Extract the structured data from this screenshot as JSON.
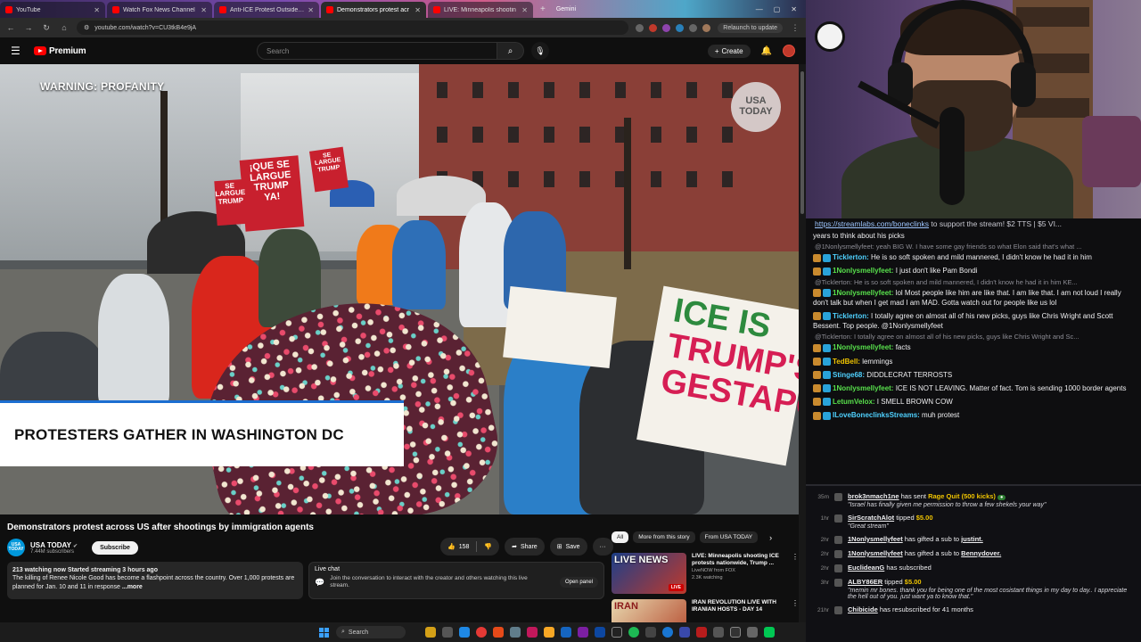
{
  "browser": {
    "tabs": [
      {
        "label": "YouTube",
        "active": false
      },
      {
        "label": "Watch Fox News Channel",
        "active": false
      },
      {
        "label": "Anti-ICE Protest Outside White",
        "active": false
      },
      {
        "label": "Demonstrators protest acr",
        "active": true
      },
      {
        "label": "LIVE: Minneapolis shootin",
        "active": false
      }
    ],
    "new_tab": "+",
    "gemini": "Gemini",
    "address": "youtube.com/watch?v=CU3tkB4e9jA",
    "relaunch": "Relaunch to update"
  },
  "yt": {
    "brand": "Premium",
    "search_placeholder": "Search",
    "create_label": "Create"
  },
  "video": {
    "warning": "WARNING: PROFANITY",
    "watermark_line1": "USA",
    "watermark_line2": "TODAY",
    "lower_third": "PROTESTERS GATHER IN WASHINGTON DC",
    "signs": {
      "que_se_1": "¡QUE SE",
      "que_se_2": "LARGUE",
      "que_se_3": "TRUMP",
      "que_se_4": "YA!",
      "se_largue_1": "SE",
      "se_largue_2": "LARGUE",
      "se_largue_3": "TRUMP",
      "ice_1": "ICE IS",
      "ice_2": "TRUMP'S",
      "ice_3": "GESTAPO"
    },
    "title": "Demonstrators protest across US after shootings by immigration agents",
    "channel": "USA TODAY",
    "channel_logo": "USA TODAY",
    "subscribers": "7.44M subscribers",
    "subscribe": "Subscribe",
    "likes": "158",
    "share": "Share",
    "save": "Save",
    "more": "···",
    "desc_meta": "213 watching now  Started streaming 3 hours ago",
    "desc_text": "The killing of Renee Nicole Good has become a flashpoint across the country. Over 1,000 protests are planned for Jan. 10 and 11 in response",
    "desc_more": "...more",
    "live_chat_title": "Live chat",
    "live_chat_text": "Join the conversation to interact with the creator and others watching this live stream.",
    "open_panel": "Open panel"
  },
  "recs": {
    "chips": [
      "All",
      "More from this story",
      "From USA TODAY"
    ],
    "items": [
      {
        "title": "LIVE: Minneapolis shooting ICE protests nationwide, Trump ...",
        "channel": "LiveNOW from FOX",
        "meta": "2.3K watching",
        "thumb_text": "LIVE NEWS",
        "badge": "LIVE"
      },
      {
        "title": "IRAN REVOLUTION LIVE WITH IRANIAN HOSTS - DAY 14",
        "channel": "",
        "meta": "",
        "thumb_text": "IRAN",
        "badge": ""
      }
    ]
  },
  "taskbar": {
    "search": "Search"
  },
  "chat": {
    "top_link": "https://streamlabs.com/boneclinks",
    "top_rest": " to support the stream! $2 TTS | $5 VI...",
    "messages": [
      {
        "type": "text",
        "user": "",
        "text": "years to think about his picks",
        "color": "#efeff1"
      },
      {
        "type": "reply",
        "text": "@1Nonlysmellyfeet: yeah BIG W. I have some gay friends so what Elon said that's what ..."
      },
      {
        "type": "msg",
        "user": "Ticklerton:",
        "text": " He is so soft spoken and mild mannered, I didn't know he had it in him",
        "color": "#4fd1ff"
      },
      {
        "type": "msg",
        "user": "1Nonlysmellyfeet:",
        "text": " I just don't like Pam Bondi",
        "color": "#58e04c"
      },
      {
        "type": "reply",
        "text": "@Ticklerton: He is so soft spoken and mild mannered, I didn't know he had it in him KE..."
      },
      {
        "type": "msg",
        "user": "1Nonlysmellyfeet:",
        "text": " lol Most people like him are like that. I am like that. I am not loud I really don't talk but when I get mad I am MAD. Gotta watch out for people like us lol",
        "color": "#58e04c"
      },
      {
        "type": "msg",
        "user": "Ticklerton:",
        "text": " I totally agree on almost all of his new picks, guys like Chris Wright and Scott Bessent. Top people. @1Nonlysmellyfeet",
        "color": "#4fd1ff"
      },
      {
        "type": "reply",
        "text": "@Ticklerton: I totally agree on almost all of his new picks, guys like Chris Wright and Sc..."
      },
      {
        "type": "msg",
        "user": "1Nonlysmellyfeet:",
        "text": " facts",
        "color": "#58e04c"
      },
      {
        "type": "msg",
        "user": "TedBell:",
        "text": " lemmings",
        "color": "#f0c400"
      },
      {
        "type": "msg",
        "user": "Stinge68:",
        "text": " DIDDLECRAT TERROSTS",
        "color": "#4fd1ff"
      },
      {
        "type": "msg",
        "user": "1Nonlysmellyfeet:",
        "text": " ICE IS NOT LEAVING. Matter of fact. Tom is sending 1000 border agents",
        "color": "#58e04c"
      },
      {
        "type": "msg",
        "user": "LetumVelox:",
        "text": " I SMELL BROWN COW",
        "color": "#58e04c"
      },
      {
        "type": "msg",
        "user": "ILoveBoneclinksStreams:",
        "text": " muh protest",
        "color": "#4fd1ff"
      }
    ],
    "events": [
      {
        "time": "35m",
        "name": "brok3nmach1ne",
        "text": " has sent ",
        "accent": "Rage Quit (500 kicks)",
        "tag": "●",
        "quote": "\"Israel has finally given me permission to throw a few shekels your way\""
      },
      {
        "time": "1hr",
        "name": "SirScratchAlot",
        "text": " tipped ",
        "accent": "$5.00",
        "tag": "",
        "quote": "\"Great stream\""
      },
      {
        "time": "2hr",
        "name": "1Nonlysmellyfeet",
        "text": " has gifted a sub to ",
        "accent": "",
        "tag": "",
        "quote": "",
        "target": "justint."
      },
      {
        "time": "2hr",
        "name": "1Nonlysmellyfeet",
        "text": " has gifted a sub to ",
        "accent": "",
        "tag": "",
        "quote": "",
        "target": "Bennydover."
      },
      {
        "time": "2hr",
        "name": "EuclideanG",
        "text": " has subscribed",
        "accent": "",
        "tag": "",
        "quote": ""
      },
      {
        "time": "3hr",
        "name": "ALBY86ER",
        "text": " tipped ",
        "accent": "$5.00",
        "tag": "",
        "quote": "\"memin mr bones. thank you for being one of the most cosistant things in my day to day.. I appreciate the hell out of you. just want ya to know that.\""
      },
      {
        "time": "21hr",
        "name": "Chibicide",
        "text": " has resubscribed for 41 months",
        "accent": "",
        "tag": "",
        "quote": ""
      }
    ]
  },
  "colors": {
    "yt_red": "#ff0000",
    "lower_third_accent": "#1b6ed1",
    "chat_bg": "#0e0e10"
  },
  "icons": [
    "hamburger-icon",
    "search-icon",
    "mic-icon",
    "bell-icon",
    "like-icon",
    "dislike-icon",
    "share-icon",
    "save-icon",
    "chat-icon",
    "windows-logo-icon"
  ]
}
